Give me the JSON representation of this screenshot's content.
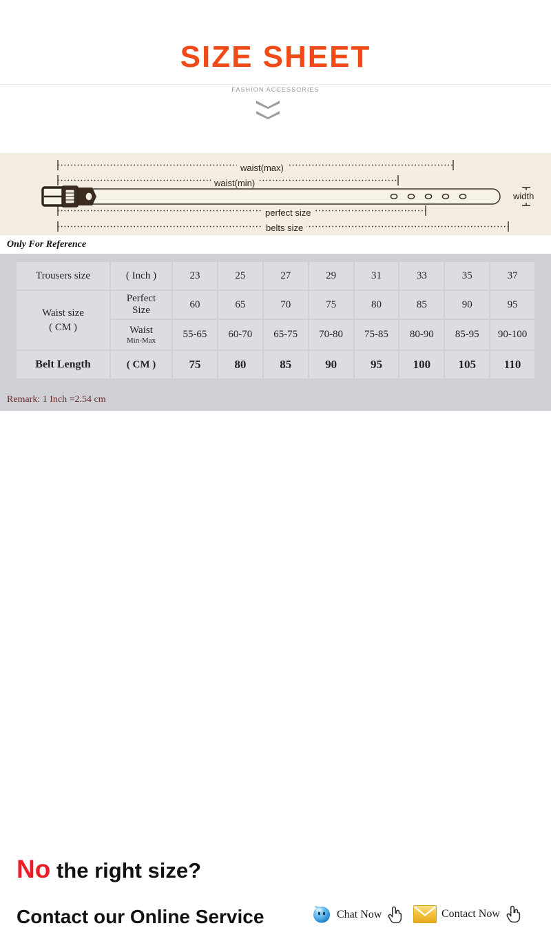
{
  "header": {
    "title": "SIZE SHEET",
    "subtitle": "FASHION ACCESSORIES",
    "title_color": "#f04b16",
    "chevron_color": "#9e9e9e"
  },
  "belt_diagram": {
    "background_color": "#f3ece0",
    "line_color": "#3b3127",
    "labels": {
      "waist_max": "waist(max)",
      "waist_min": "waist(min)",
      "perfect_size": "perfect size",
      "belts_size": "belts size",
      "width": "width"
    },
    "hole_count": 5,
    "note": "Only For Reference"
  },
  "table": {
    "band_color": "#cfcfd6",
    "cell_color": "#dcdce1",
    "rows": [
      {
        "label": "Trousers size",
        "unit": "( Inch )",
        "values": [
          "23",
          "25",
          "27",
          "29",
          "31",
          "33",
          "35",
          "37"
        ]
      },
      {
        "label": "Waist size",
        "label_line2": "( CM )",
        "unit": "Perfect Size",
        "unit_line1": "Perfect",
        "unit_line2": "Size",
        "values": [
          "60",
          "65",
          "70",
          "75",
          "80",
          "85",
          "90",
          "95"
        ]
      },
      {
        "unit_line1": "Waist",
        "unit_line2": "Min-Max",
        "values": [
          "55-65",
          "60-70",
          "65-75",
          "70-80",
          "75-85",
          "80-90",
          "85-95",
          "90-100"
        ]
      },
      {
        "label": "Belt Length",
        "unit": "( CM )",
        "values": [
          "75",
          "80",
          "85",
          "90",
          "95",
          "100",
          "105",
          "110"
        ]
      }
    ],
    "remark": "Remark: 1 Inch =2.54 cm",
    "remark_color": "#6b2b2b"
  },
  "cta": {
    "headline_highlight": "No",
    "headline_rest": "the right size?",
    "headline_highlight_color": "#ec1c24",
    "contact_line": "Contact our Online Service",
    "services": [
      {
        "label": "Chat Now",
        "icon": "chat-bubble-icon",
        "icon_color": "#3d9ee0"
      },
      {
        "label": "Contact Now",
        "icon": "envelope-icon",
        "icon_color": "#f0c030"
      }
    ],
    "cursor_icon": "pointing-hand-cursor-icon"
  }
}
